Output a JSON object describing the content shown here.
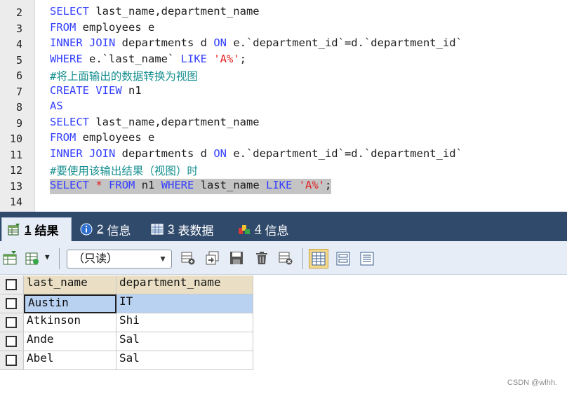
{
  "editor": {
    "line_numbers": [
      "2",
      "3",
      "4",
      "5",
      "6",
      "7",
      "8",
      "9",
      "10",
      "11",
      "12",
      "13",
      "14"
    ],
    "lines": [
      [
        {
          "t": "kw",
          "v": "SELECT"
        },
        {
          "t": "tx",
          "v": " last_name,department_name"
        }
      ],
      [
        {
          "t": "kw",
          "v": "FROM"
        },
        {
          "t": "tx",
          "v": " employees e"
        }
      ],
      [
        {
          "t": "kw",
          "v": "INNER JOIN"
        },
        {
          "t": "tx",
          "v": " departments d "
        },
        {
          "t": "kw",
          "v": "ON"
        },
        {
          "t": "tx",
          "v": " e.`department_id`=d.`department_id`"
        }
      ],
      [
        {
          "t": "kw",
          "v": "WHERE"
        },
        {
          "t": "tx",
          "v": " e.`last_name` "
        },
        {
          "t": "kw",
          "v": "LIKE"
        },
        {
          "t": "tx",
          "v": " "
        },
        {
          "t": "str",
          "v": "'A%'"
        },
        {
          "t": "tx",
          "v": ";"
        }
      ],
      [
        {
          "t": "cmt",
          "v": "#将上面输出的数据转换为视图"
        }
      ],
      [
        {
          "t": "kw",
          "v": "CREATE VIEW"
        },
        {
          "t": "tx",
          "v": " n1"
        }
      ],
      [
        {
          "t": "kw",
          "v": "AS"
        }
      ],
      [
        {
          "t": "kw",
          "v": "SELECT"
        },
        {
          "t": "tx",
          "v": " last_name,department_name"
        }
      ],
      [
        {
          "t": "kw",
          "v": "FROM"
        },
        {
          "t": "tx",
          "v": " employees e"
        }
      ],
      [
        {
          "t": "kw",
          "v": "INNER JOIN"
        },
        {
          "t": "tx",
          "v": " departments d "
        },
        {
          "t": "kw",
          "v": "ON"
        },
        {
          "t": "tx",
          "v": " e.`department_id`=d.`department_id`"
        }
      ],
      [
        {
          "t": "cmt",
          "v": "#要使用该输出结果（视图）时"
        }
      ],
      [
        {
          "t": "kw",
          "v": "SELECT"
        },
        {
          "t": "tx",
          "v": " "
        },
        {
          "t": "str",
          "v": "*"
        },
        {
          "t": "tx",
          "v": " "
        },
        {
          "t": "kw",
          "v": "FROM"
        },
        {
          "t": "tx",
          "v": " n1 "
        },
        {
          "t": "kw",
          "v": "WHERE"
        },
        {
          "t": "tx",
          "v": " last_name "
        },
        {
          "t": "kw",
          "v": "LIKE"
        },
        {
          "t": "tx",
          "v": " "
        },
        {
          "t": "str",
          "v": "'A%'"
        },
        {
          "t": "tx",
          "v": ";"
        }
      ],
      []
    ],
    "selected_line_number": "13"
  },
  "tabs": [
    {
      "num": "1",
      "label": "结果",
      "icon": "table-result-icon",
      "active": true
    },
    {
      "num": "2",
      "label": "信息",
      "icon": "info-icon",
      "active": false
    },
    {
      "num": "3",
      "label": "表数据",
      "icon": "table-data-icon",
      "active": false
    },
    {
      "num": "4",
      "label": "信息",
      "icon": "info-blocks-icon",
      "active": false
    }
  ],
  "toolbar": {
    "mode_select_value": "（只读）"
  },
  "grid": {
    "columns": [
      "last_name",
      "department_name"
    ],
    "rows": [
      [
        "Austin",
        "IT"
      ],
      [
        "Atkinson",
        "Shi"
      ],
      [
        "Ande",
        "Sal"
      ],
      [
        "Abel",
        "Sal"
      ]
    ],
    "selected_row": 0
  },
  "colors": {
    "keyword": "#3340ff",
    "string": "#e21c1c",
    "comment": "#148e8e",
    "tab_bar": "#304a6b",
    "toolbar_bg": "#e6edf7",
    "header_bg": "#eadfc4",
    "selected_row_bg": "#b9d2f2"
  },
  "watermark": "CSDN @wlhh."
}
